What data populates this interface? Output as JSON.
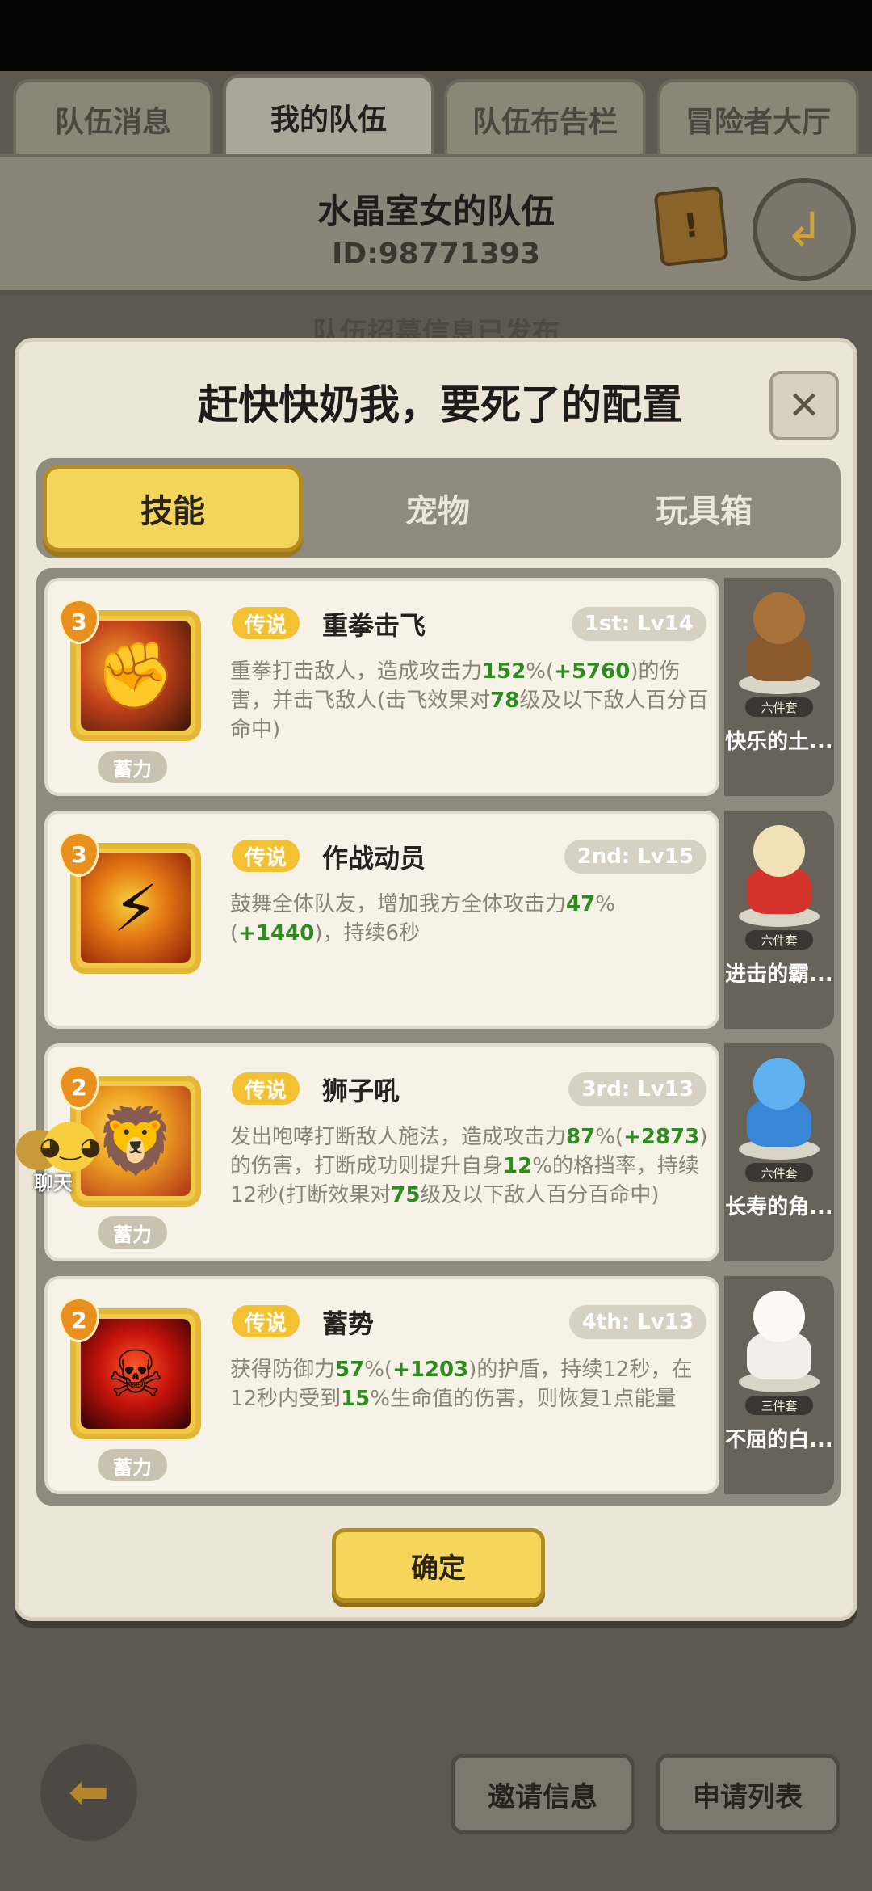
{
  "tabs": [
    {
      "label": "队伍消息",
      "active": false
    },
    {
      "label": "我的队伍",
      "active": true
    },
    {
      "label": "队伍布告栏",
      "active": false
    },
    {
      "label": "冒险者大厅",
      "active": false
    }
  ],
  "team": {
    "name": "水晶室女的队伍",
    "id": "ID:98771393",
    "notice": "队伍招募信息已发布"
  },
  "modal": {
    "title": "赶快快奶我，要死了的配置",
    "close_icon": "close-icon",
    "segments": [
      {
        "label": "技能",
        "active": true
      },
      {
        "label": "宠物",
        "active": false
      },
      {
        "label": "玩具箱",
        "active": false
      }
    ],
    "skills": [
      {
        "level": "3",
        "rarity": "传说",
        "name": "重拳击飞",
        "slot": "1st: Lv14",
        "tag": "蓄力",
        "desc": [
          {
            "t": "重拳打击敌人，造成攻击力"
          },
          {
            "t": "152",
            "h": true
          },
          {
            "t": "%("
          },
          {
            "t": "+5760",
            "h": true
          },
          {
            "t": ")的伤害，并击飞敌人(击飞效果对"
          },
          {
            "t": "78",
            "h": true
          },
          {
            "t": "级及以下敌人百分百命中)"
          }
        ],
        "pet": {
          "set": "六件套",
          "name": "快乐的土..."
        }
      },
      {
        "level": "3",
        "rarity": "传说",
        "name": "作战动员",
        "slot": "2nd: Lv15",
        "tag": "",
        "desc": [
          {
            "t": "鼓舞全体队友，增加我方全体攻击力"
          },
          {
            "t": "47",
            "h": true
          },
          {
            "t": "%("
          },
          {
            "t": "+1440",
            "h": true
          },
          {
            "t": ")，持续6秒"
          }
        ],
        "pet": {
          "set": "六件套",
          "name": "进击的霸..."
        }
      },
      {
        "level": "2",
        "rarity": "传说",
        "name": "狮子吼",
        "slot": "3rd: Lv13",
        "tag": "蓄力",
        "desc": [
          {
            "t": "发出咆哮打断敌人施法，造成攻击力"
          },
          {
            "t": "87",
            "h": true
          },
          {
            "t": "%("
          },
          {
            "t": "+2873",
            "h": true
          },
          {
            "t": ")的伤害，打断成功则提升自身"
          },
          {
            "t": "12",
            "h": true
          },
          {
            "t": "%的格挡率，持续12秒(打断效果对"
          },
          {
            "t": "75",
            "h": true
          },
          {
            "t": "级及以下敌人百分百命中)"
          }
        ],
        "pet": {
          "set": "六件套",
          "name": "长寿的角..."
        }
      },
      {
        "level": "2",
        "rarity": "传说",
        "name": "蓄势",
        "slot": "4th: Lv13",
        "tag": "蓄力",
        "desc": [
          {
            "t": "获得防御力"
          },
          {
            "t": "57",
            "h": true
          },
          {
            "t": "%("
          },
          {
            "t": "+1203",
            "h": true
          },
          {
            "t": ")的护盾，持续12秒，在12秒内受到"
          },
          {
            "t": "15",
            "h": true
          },
          {
            "t": "%生命值的伤害，则恢复1点能量"
          }
        ],
        "pet": {
          "set": "三件套",
          "name": "不屈的白..."
        }
      }
    ],
    "confirm_label": "确定"
  },
  "chat": {
    "label": "聊天"
  },
  "bottom": {
    "back_icon": "back-arrow-icon",
    "invite_label": "邀请信息",
    "apply_label": "申请列表"
  }
}
